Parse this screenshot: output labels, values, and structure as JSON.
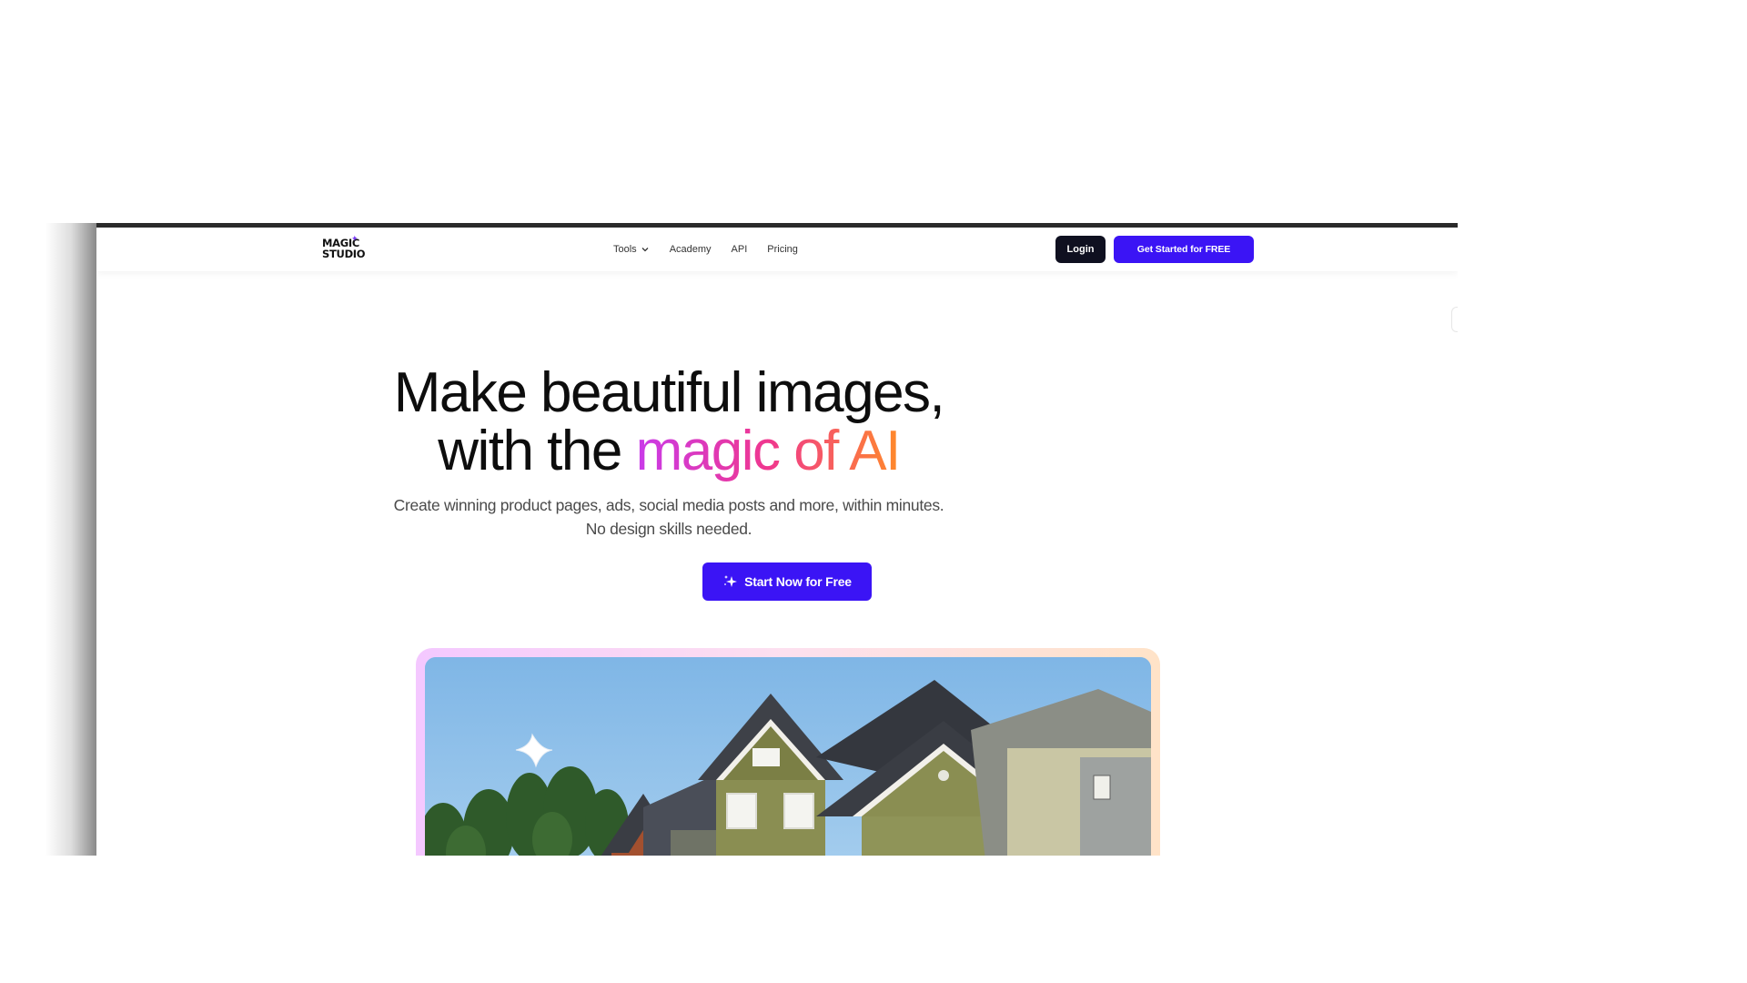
{
  "brand": {
    "logo_line1": "MAGIC",
    "logo_line2": "STUDIO"
  },
  "nav": {
    "items": [
      {
        "label": "Tools",
        "has_dropdown": true
      },
      {
        "label": "Academy"
      },
      {
        "label": "API"
      },
      {
        "label": "Pricing"
      }
    ]
  },
  "header_actions": {
    "login_label": "Login",
    "get_started_label": "Get Started for FREE"
  },
  "hero": {
    "title_line1": "Make beautiful images,",
    "title_line2_prefix": "with the ",
    "title_line2_highlight": "magic of AI",
    "subtitle_line1": "Create winning product pages, ads, social media posts and more, within minutes.",
    "subtitle_line2": "No design skills needed.",
    "cta_label": "Start Now for Free"
  },
  "showcase": {
    "image_subject": "suburban houses under blue sky"
  },
  "colors": {
    "primary": "#3b14f5",
    "dark_button": "#0f1020",
    "gradient_start": "#c93bea",
    "gradient_mid": "#f0378e",
    "gradient_end": "#ff8a2a"
  },
  "icons": {
    "cta_icon": "sparkle-icon",
    "tools_caret": "chevron-down-icon",
    "image_badge": "star-sparkle-icon"
  }
}
